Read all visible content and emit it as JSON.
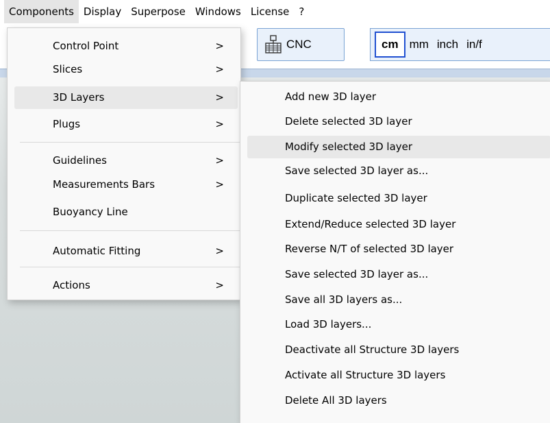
{
  "menubar": {
    "items": [
      {
        "label": "Components"
      },
      {
        "label": "Display"
      },
      {
        "label": "Superpose"
      },
      {
        "label": "Windows"
      },
      {
        "label": "License"
      },
      {
        "label": "?"
      }
    ]
  },
  "toolbar": {
    "cnc_label": "CNC",
    "units": [
      "cm",
      "mm",
      "inch",
      "in/f"
    ],
    "selected_unit": "cm"
  },
  "components_menu": {
    "items": [
      {
        "label": "Control Point",
        "arrow": ">"
      },
      {
        "label": "Slices",
        "arrow": ">"
      },
      {
        "label": "3D Layers",
        "arrow": ">"
      },
      {
        "label": "Plugs",
        "arrow": ">"
      },
      {
        "label": "Guidelines",
        "arrow": ">"
      },
      {
        "label": "Measurements Bars",
        "arrow": ">"
      },
      {
        "label": "Buoyancy Line",
        "arrow": ""
      },
      {
        "label": "Automatic Fitting",
        "arrow": ">"
      },
      {
        "label": "Actions",
        "arrow": ">"
      }
    ]
  },
  "layers_menu": {
    "items": [
      {
        "label": "Add new 3D layer"
      },
      {
        "label": "Delete selected 3D layer"
      },
      {
        "label": "Modify selected 3D layer"
      },
      {
        "label": "Save selected 3D layer as..."
      },
      {
        "label": "Duplicate selected 3D layer"
      },
      {
        "label": "Extend/Reduce selected 3D layer"
      },
      {
        "label": "Reverse N/T of selected 3D layer"
      },
      {
        "label": "Save selected 3D layer as..."
      },
      {
        "label": "Save all 3D layers as..."
      },
      {
        "label": "Load 3D layers..."
      },
      {
        "label": "Deactivate all Structure 3D layers"
      },
      {
        "label": "Activate all Structure 3D layers"
      },
      {
        "label": "Delete All 3D layers"
      }
    ]
  }
}
